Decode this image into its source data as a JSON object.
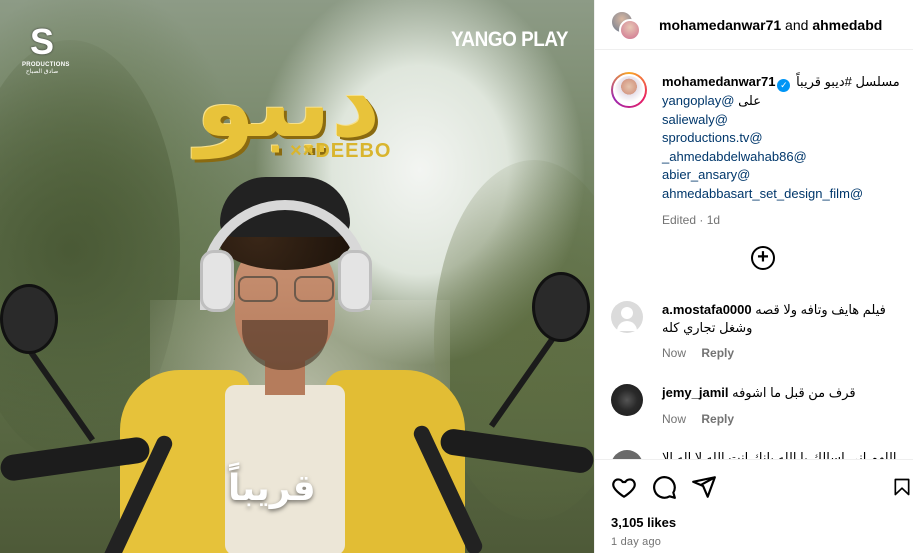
{
  "poster": {
    "logo_letter": "S",
    "logo_sub1": "PRODUCTIONS",
    "logo_sub2": "صادق الصباح",
    "brand": "YANGO PLAY",
    "title_ar": "ديبو",
    "title_en": "××DEEBO",
    "soon": "قريباً"
  },
  "header": {
    "user1": "mohamedanwar71",
    "joiner": " and ",
    "user2": "ahmedabd"
  },
  "caption": {
    "user": "mohamedanwar71",
    "verified_icon": "verified-badge-icon",
    "text": "مسلسل #ديبو قريباً",
    "line2_prefix": "على",
    "tags": [
      "yangoplay@",
      "saliewaly@",
      "sproductions.tv@",
      "_ahmedabdelwahab86@",
      "abier_ansary@",
      "ahmedabbasart_set_design_film@"
    ],
    "meta": "Edited · 1d"
  },
  "load_more_icon": "plus-circle-icon",
  "comments": [
    {
      "user": "a.mostafa0000",
      "text": "فيلم هايف وتافه ولا قصه وشغل تجاري كله",
      "time": "Now",
      "reply": "Reply"
    },
    {
      "user": "jemy_jamil",
      "text": "قرف من قبل ما اشوفه",
      "time": "Now",
      "reply": "Reply"
    }
  ],
  "partial_comment": "اللهم اني اسالك يا الله بانك انت الله لا اله الا",
  "actions": {
    "like_icon": "heart-icon",
    "comment_icon": "comment-icon",
    "share_icon": "paper-plane-icon",
    "save_icon": "bookmark-icon"
  },
  "likes": "3,105 likes",
  "date": "1 day ago"
}
